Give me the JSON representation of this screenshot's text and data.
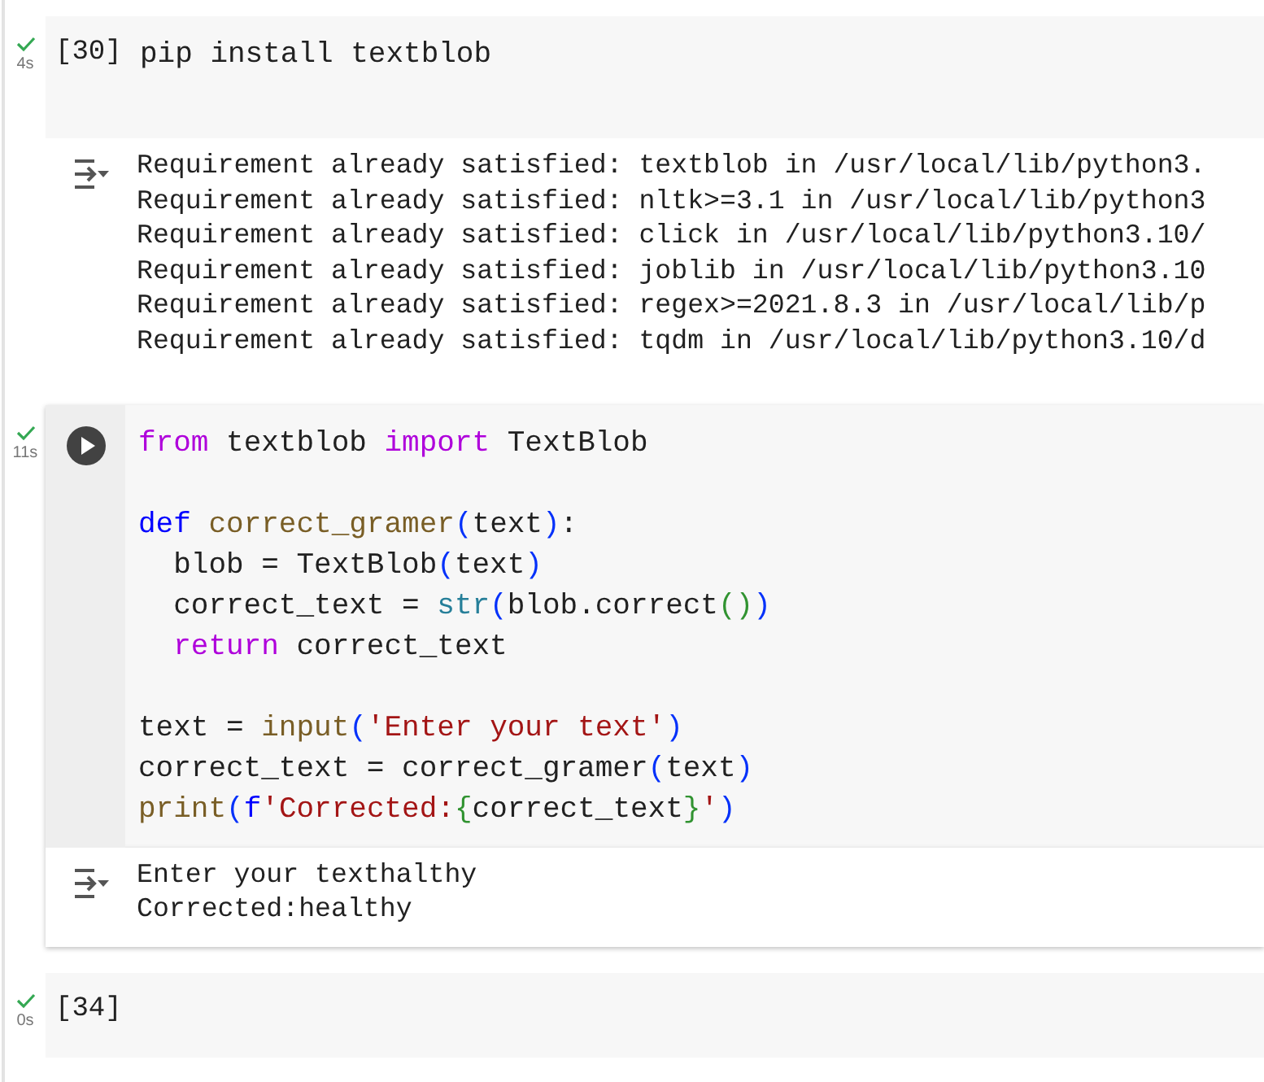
{
  "cells": [
    {
      "done": true,
      "time": "4s",
      "prompt": "[30]",
      "selected": false,
      "code": [
        {
          "kind": "code",
          "tokens": [
            {
              "kind": "plain",
              "text": "pip install textblob"
            }
          ]
        }
      ],
      "output": [
        "Requirement already satisfied: textblob in /usr/local/lib/python3.",
        "Requirement already satisfied: nltk>=3.1 in /usr/local/lib/python3",
        "Requirement already satisfied: click in /usr/local/lib/python3.10/",
        "Requirement already satisfied: joblib in /usr/local/lib/python3.10",
        "Requirement already satisfied: regex>=2021.8.3 in /usr/local/lib/p",
        "Requirement already satisfied: tqdm in /usr/local/lib/python3.10/d"
      ]
    },
    {
      "done": true,
      "time": "11s",
      "selected": true,
      "code": [
        {
          "kind": "code",
          "tokens": [
            {
              "kind": "keyword",
              "text": "from"
            },
            {
              "kind": "plain",
              "text": " textblob "
            },
            {
              "kind": "keyword",
              "text": "import"
            },
            {
              "kind": "plain",
              "text": " TextBlob"
            }
          ]
        },
        {
          "kind": "blank"
        },
        {
          "kind": "code",
          "tokens": [
            {
              "kind": "storage",
              "text": "def "
            },
            {
              "kind": "function",
              "text": "correct_gramer"
            },
            {
              "kind": "bracket1",
              "text": "("
            },
            {
              "kind": "plain",
              "text": "text"
            },
            {
              "kind": "bracket1",
              "text": ")"
            },
            {
              "kind": "plain",
              "text": ":"
            }
          ]
        },
        {
          "kind": "code",
          "tokens": [
            {
              "kind": "plain",
              "text": "  blob = TextBlob"
            },
            {
              "kind": "bracket1",
              "text": "("
            },
            {
              "kind": "plain",
              "text": "text"
            },
            {
              "kind": "bracket1",
              "text": ")"
            }
          ]
        },
        {
          "kind": "code",
          "tokens": [
            {
              "kind": "plain",
              "text": "  correct_text = "
            },
            {
              "kind": "builtin",
              "text": "str"
            },
            {
              "kind": "bracket1",
              "text": "("
            },
            {
              "kind": "plain",
              "text": "blob.correct"
            },
            {
              "kind": "bracket2",
              "text": "()"
            },
            {
              "kind": "bracket1",
              "text": ")"
            }
          ]
        },
        {
          "kind": "code",
          "tokens": [
            {
              "kind": "keyword",
              "text": "  return"
            },
            {
              "kind": "plain",
              "text": " correct_text"
            }
          ]
        },
        {
          "kind": "blank"
        },
        {
          "kind": "code",
          "tokens": [
            {
              "kind": "plain",
              "text": "text = "
            },
            {
              "kind": "function",
              "text": "input"
            },
            {
              "kind": "bracket1",
              "text": "("
            },
            {
              "kind": "string",
              "text": "'Enter your text'"
            },
            {
              "kind": "bracket1",
              "text": ")"
            }
          ]
        },
        {
          "kind": "code",
          "tokens": [
            {
              "kind": "plain",
              "text": "correct_text = correct_gramer"
            },
            {
              "kind": "bracket1",
              "text": "("
            },
            {
              "kind": "plain",
              "text": "text"
            },
            {
              "kind": "bracket1",
              "text": ")"
            }
          ]
        },
        {
          "kind": "code",
          "tokens": [
            {
              "kind": "function",
              "text": "print"
            },
            {
              "kind": "bracket1",
              "text": "("
            },
            {
              "kind": "storage",
              "text": "f"
            },
            {
              "kind": "string",
              "text": "'Corrected:"
            },
            {
              "kind": "bracket2",
              "text": "{"
            },
            {
              "kind": "plain",
              "text": "correct_text"
            },
            {
              "kind": "bracket2",
              "text": "}"
            },
            {
              "kind": "string",
              "text": "'"
            },
            {
              "kind": "bracket1",
              "text": ")"
            }
          ]
        }
      ],
      "output": [
        "Enter your texthalthy",
        "Corrected:healthy"
      ]
    },
    {
      "done": true,
      "time": "0s",
      "prompt": "[34]",
      "selected": false
    }
  ]
}
